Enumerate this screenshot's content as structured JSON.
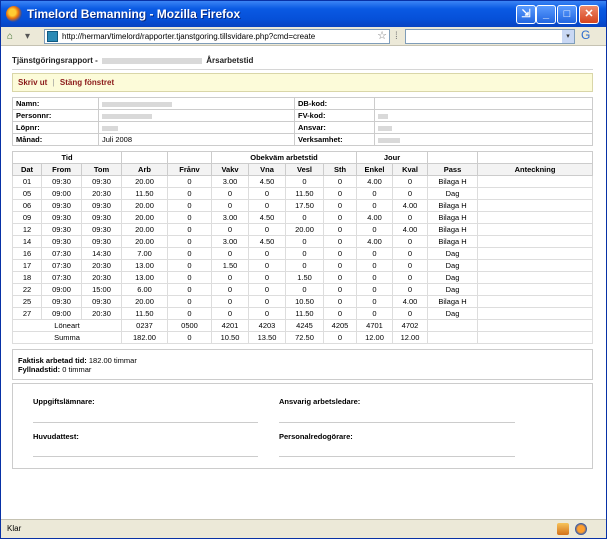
{
  "window": {
    "title": "Timelord Bemanning - Mozilla Firefox",
    "url": "http://herman/timelord/rapporter.tjanstgoring.tillsvidare.php?cmd=create",
    "status": "Klar"
  },
  "page": {
    "crumb_start": "Tjänstgöringsrapport -",
    "crumb_end": "Årsarbetstid",
    "actions": {
      "print": "Skriv ut",
      "separator": "|",
      "close": "Stäng fönstret"
    }
  },
  "info": {
    "name_label": "Namn:",
    "personnr_label": "Personnr:",
    "lopnr_label": "Löpnr:",
    "manad_label": "Månad:",
    "manad_value": "Juli 2008",
    "db_label": "DB-kod:",
    "fv_label": "FV-kod:",
    "ansvar_label": "Ansvar:",
    "verksamhet_label": "Verksamhet:"
  },
  "table": {
    "group_headers": {
      "tid": "Tid",
      "obekvam": "Obekväm arbetstid",
      "jour": "Jour"
    },
    "columns": [
      "Dat",
      "From",
      "Tom",
      "Arb",
      "Frånv",
      "Vakv",
      "Vna",
      "Vesl",
      "Sth",
      "Enkel",
      "Kval",
      "Pass",
      "Anteckning"
    ],
    "rows": [
      [
        "01",
        "09:30",
        "09:30",
        "20.00",
        "0",
        "3.00",
        "4.50",
        "0",
        "0",
        "4.00",
        "0",
        "Bilaga H",
        ""
      ],
      [
        "05",
        "09:00",
        "20:30",
        "11.50",
        "0",
        "0",
        "0",
        "11.50",
        "0",
        "0",
        "0",
        "Dag",
        ""
      ],
      [
        "06",
        "09:30",
        "09:30",
        "20.00",
        "0",
        "0",
        "0",
        "17.50",
        "0",
        "0",
        "4.00",
        "Bilaga H",
        ""
      ],
      [
        "09",
        "09:30",
        "09:30",
        "20.00",
        "0",
        "3.00",
        "4.50",
        "0",
        "0",
        "4.00",
        "0",
        "Bilaga H",
        ""
      ],
      [
        "12",
        "09:30",
        "09:30",
        "20.00",
        "0",
        "0",
        "0",
        "20.00",
        "0",
        "0",
        "4.00",
        "Bilaga H",
        ""
      ],
      [
        "14",
        "09:30",
        "09:30",
        "20.00",
        "0",
        "3.00",
        "4.50",
        "0",
        "0",
        "4.00",
        "0",
        "Bilaga H",
        ""
      ],
      [
        "16",
        "07:30",
        "14:30",
        "7.00",
        "0",
        "0",
        "0",
        "0",
        "0",
        "0",
        "0",
        "Dag",
        ""
      ],
      [
        "17",
        "07:30",
        "20:30",
        "13.00",
        "0",
        "1.50",
        "0",
        "0",
        "0",
        "0",
        "0",
        "Dag",
        ""
      ],
      [
        "18",
        "07:30",
        "20:30",
        "13.00",
        "0",
        "0",
        "0",
        "1.50",
        "0",
        "0",
        "0",
        "Dag",
        ""
      ],
      [
        "22",
        "09:00",
        "15:00",
        "6.00",
        "0",
        "0",
        "0",
        "0",
        "0",
        "0",
        "0",
        "Dag",
        ""
      ],
      [
        "25",
        "09:30",
        "09:30",
        "20.00",
        "0",
        "0",
        "0",
        "10.50",
        "0",
        "0",
        "4.00",
        "Bilaga H",
        ""
      ],
      [
        "27",
        "09:00",
        "20:30",
        "11.50",
        "0",
        "0",
        "0",
        "11.50",
        "0",
        "0",
        "0",
        "Dag",
        ""
      ]
    ],
    "loneart_label": "Löneart",
    "loneart": [
      "0237",
      "0500",
      "4201",
      "4203",
      "4245",
      "4205",
      "4701",
      "4702"
    ],
    "summa_label": "Summa",
    "summa": [
      "182.00",
      "0",
      "10.50",
      "13.50",
      "72.50",
      "0",
      "12.00",
      "12.00"
    ]
  },
  "summary": {
    "faktisk_label": "Faktisk arbetad tid:",
    "faktisk_value": "182.00 timmar",
    "fyllnad_label": "Fyllnadstid:",
    "fyllnad_value": "0 timmar"
  },
  "sign": {
    "uppgift": "Uppgiftslämnare:",
    "ansvarig": "Ansvarig arbetsledare:",
    "huvud": "Huvudattest:",
    "personal": "Personalredogörare:"
  }
}
